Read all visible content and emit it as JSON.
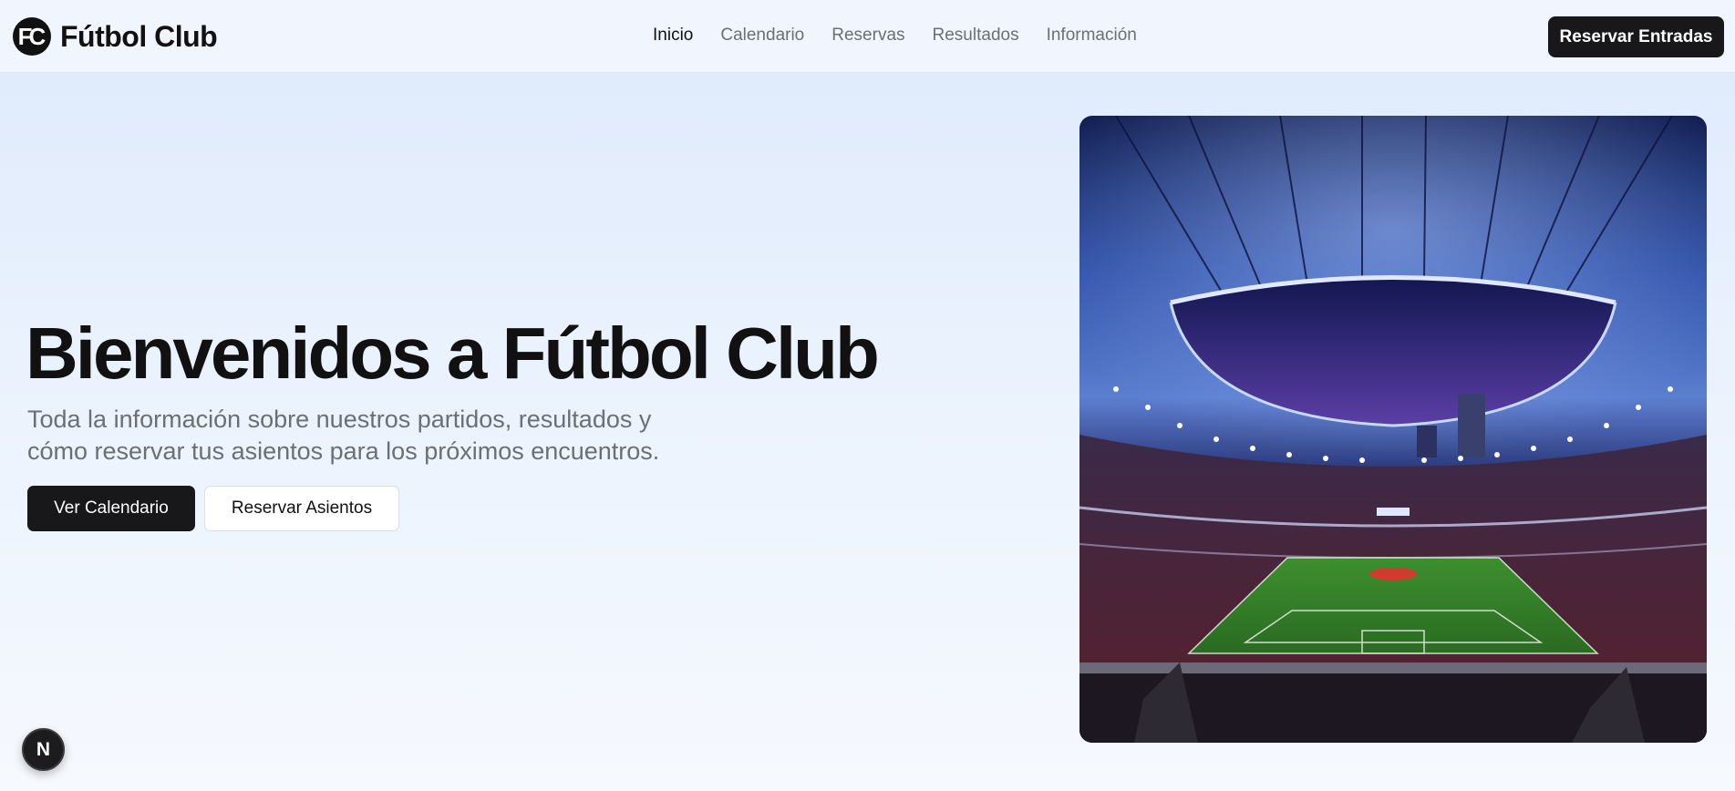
{
  "header": {
    "logo_text": "FC",
    "brand_name": "Fútbol Club",
    "nav": [
      {
        "label": "Inicio",
        "active": true
      },
      {
        "label": "Calendario",
        "active": false
      },
      {
        "label": "Reservas",
        "active": false
      },
      {
        "label": "Resultados",
        "active": false
      },
      {
        "label": "Información",
        "active": false
      }
    ],
    "cta_label": "Reservar Entradas"
  },
  "hero": {
    "title": "Bienvenidos a Fútbol Club",
    "subtitle": "Toda la información sobre nuestros partidos, resultados y cómo reservar tus asientos para los próximos encuentros.",
    "primary_button": "Ver Calendario",
    "secondary_button": "Reservar Asientos",
    "image_icon": "stadium-image"
  },
  "floating_badge": {
    "label": "N",
    "icon": "next-logo-icon"
  },
  "colors": {
    "primary": "#18181b",
    "text_muted": "#6b6f76",
    "background": "#eaf2fd"
  }
}
